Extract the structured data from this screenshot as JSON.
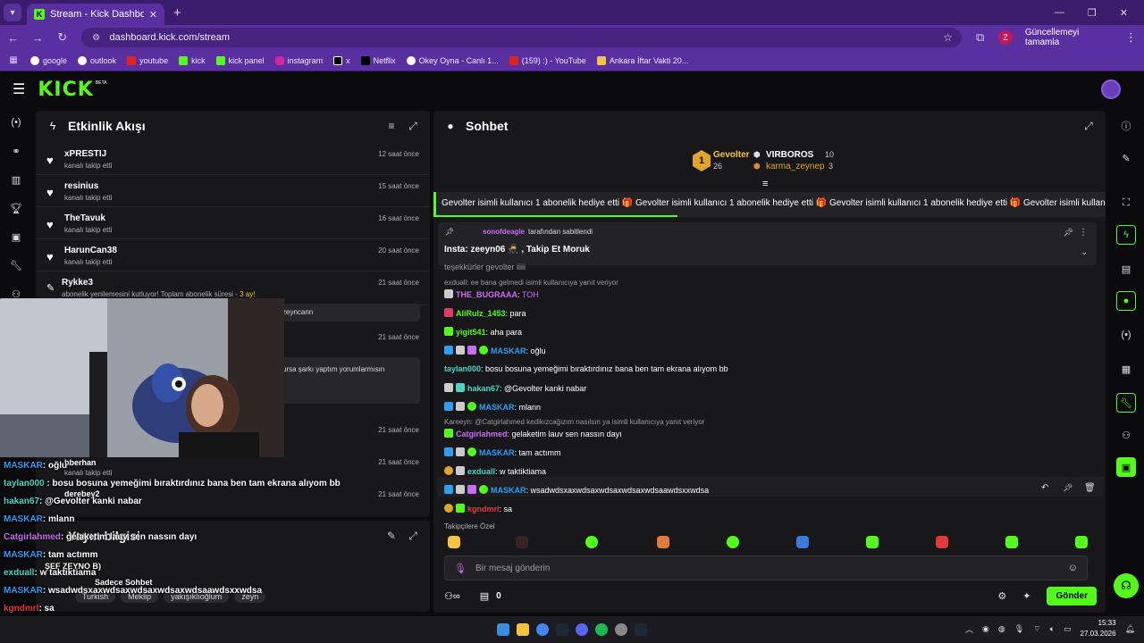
{
  "browser": {
    "tab_title": "Stream - Kick Dashboard",
    "url": "dashboard.kick.com/stream",
    "profile_letter": "Z",
    "update_label": "Güncellemeyi tamamla",
    "bookmarks": [
      "google",
      "outlook",
      "youtube",
      "kick",
      "kick panel",
      "instagram",
      "x",
      "Netflix",
      "Okey Oyna - Canlı 1...",
      "(159) :) - YouTube",
      "Ankara İftar Vakti 20..."
    ]
  },
  "kick": {
    "logo": "KICK",
    "beta": "BETA"
  },
  "activity": {
    "title": "Etkinlik Akışı",
    "items": [
      {
        "name": "xPRESTIJ",
        "sub": "kanalı takip etti",
        "time": "12 saat önce"
      },
      {
        "name": "resinius",
        "sub": "kanalı takip etti",
        "time": "15 saat önce"
      },
      {
        "name": "TheTavuk",
        "sub": "kanalı takip etti",
        "time": "16 saat önce"
      },
      {
        "name": "HarunCan38",
        "sub": "kanalı takip etti",
        "time": "20 saat önce"
      },
      {
        "name": "Rykke3",
        "sub": "abonelik yenilemesini kutluyor! Toplam abonelik süresi -",
        "sub_highlight": "3 ay!",
        "time": "21 saat önce"
      }
    ],
    "partial_texts": {
      "zeyncann": "zeyncann",
      "sarki": "ursa şarkı yaptım yorumlarmısın",
      "time_377": "21 saat önce",
      "time_481": "21 saat önce",
      "time_517": "21 saat önce",
      "time_553": "21 saat önce",
      "bberhan": "bberhan",
      "kanali_takip": "kanalı takip etti",
      "derebey2": "derebey2"
    }
  },
  "stream_info": {
    "title": "Yayın bilgisi",
    "tags": [
      "Turkish",
      "Meklip",
      "yakışıklıoğlum",
      "zeyn"
    ]
  },
  "overlay_chat": [
    {
      "user": "MASKAR",
      "text": ": oğlu"
    },
    {
      "user": "taylan000",
      "text": " : bosu bosuna yemeğimi bıraktırdınız bana ben tam ekrana alıyom bb"
    },
    {
      "user": "hakan67",
      "text": ": @Gevolter kanki nabar"
    },
    {
      "user": "MASKAR",
      "text": ": mlann"
    },
    {
      "user": "Catgirlahmed",
      "text": ": gelaketim lauv sen nassın dayı"
    },
    {
      "user": "ŞEF ZEYNO B)",
      "text": ""
    },
    {
      "user": "MASKAR",
      "text": ": tam actımm"
    },
    {
      "user": "exduall",
      "text": ": w taktiktiama"
    },
    {
      "user": "Sadece Sohbet",
      "text": ""
    },
    {
      "user": "MASKAR",
      "text": ": wsadwdsxaxwdsaxwdsaxwdsaxwdsaawdsxxwdsa"
    },
    {
      "user": "kgndmrl",
      "text": ": sa"
    }
  ],
  "chat": {
    "title": "Sohbet",
    "leaderboard": {
      "rank": "1",
      "first": {
        "name": "Gevolter",
        "count": "26"
      },
      "second": {
        "name": "VIRBOROS",
        "count": "10"
      },
      "third": {
        "name": "karma_zeynep",
        "count": "3"
      }
    },
    "gift_bar": "Gevolter isimli kullanıcı 1 abonelik hediye etti   🎁 Gevolter isimli kullanıcı 1 abonelik hediye etti   🎁 Gevolter isimli kullanıcı 1 abonelik hediye etti   🎁 Gevolter isimli kullanıcı 1 abonelik hediye etti   🎁 Gevolter isimli kullanıcı 1 abonelik hediye etti",
    "pinned": {
      "by_user": "sonofdeagle",
      "by_suffix": "tarafından sabitlendi",
      "text": "Insta: zeeyn06 🥷 , Takip Et Moruk"
    },
    "messages": [
      {
        "type": "cut",
        "user": "",
        "text": "teşekkürler gevolter iiiii"
      },
      {
        "type": "reply",
        "text": "exduall: ee bana gelmedi isimli kullanıcıya yanıt veriyor"
      },
      {
        "type": "msg",
        "user": "THE_BUGRAAA",
        "color": "#c86cf5",
        "text": ": ",
        "extra": "TOH"
      },
      {
        "type": "msg",
        "user": "AliRulz_1453",
        "color": "#53fc18",
        "text": ": para"
      },
      {
        "type": "msg",
        "user": "yigit541",
        "color": "#53fc18",
        "text": ": aha para"
      },
      {
        "type": "msg",
        "user": "MASKAR",
        "color": "#2f9cf5",
        "text": ": oğlu"
      },
      {
        "type": "msg",
        "user": "taylan000",
        "color": "#4ad6c9",
        "text": ": bosu bosuna yemeğimi bıraktırdınız bana ben tam ekrana alıyom bb"
      },
      {
        "type": "msg",
        "user": "hakan67",
        "color": "#4ad6c9",
        "text": ": @Gevolter kanki nabar"
      },
      {
        "type": "msg",
        "user": "MASKAR",
        "color": "#2f9cf5",
        "text": ": mlann"
      },
      {
        "type": "reply",
        "text": "Kareeyn: @Catgirlahmed kedikızcağızım nasılsın ya isimli kullanıcıya yanıt veriyor"
      },
      {
        "type": "msg",
        "user": "Catgirlahmed",
        "color": "#c86cf5",
        "text": ": gelaketim lauv sen nassın dayı"
      },
      {
        "type": "msg",
        "user": "MASKAR",
        "color": "#2f9cf5",
        "text": ": tam actımm"
      },
      {
        "type": "msg",
        "user": "exduall",
        "color": "#4ad6c9",
        "text": ": w taktiktiama"
      },
      {
        "type": "msg",
        "user": "MASKAR",
        "color": "#2f9cf5",
        "text": ": wsadwdsxaxwdsaxwdsaxwdsaxwdsaawdsxxwdsa"
      },
      {
        "type": "msg",
        "user": "kgndmrl",
        "color": "#e03b3b",
        "text": ": sa"
      }
    ],
    "followers_only": "Takipçilere Özel",
    "input_placeholder": "Bir mesaj gönderin",
    "points_count": "0",
    "send_label": "Gönder"
  },
  "taskbar": {
    "time": "15:33",
    "date": "27.03.2026"
  },
  "colors": {
    "accent": "#53fc18",
    "browser_purple": "#5a2fa0"
  }
}
